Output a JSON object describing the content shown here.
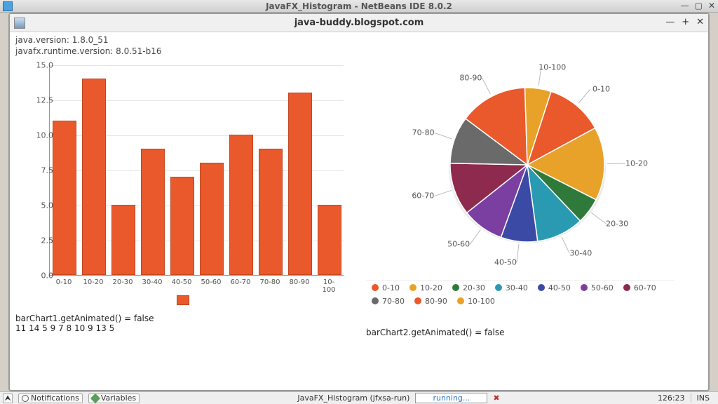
{
  "outer_window_title": "JavaFX_Histogram - NetBeans IDE 8.0.2",
  "inner_window_title": "java-buddy.blogspot.com",
  "sysinfo": {
    "line1": "java.version: 1.8.0_51",
    "line2": "javafx.runtime.version: 8.0.51-b16"
  },
  "bar_caption": "barChart1.getAnimated() = false",
  "bar_values_line": "11 14 5 9 7 8 10 9 13 5",
  "pie_caption": "barChart2.getAnimated() = false",
  "statusbar": {
    "notifications": "Notifications",
    "variables": "Variables",
    "task": "JavaFX_Histogram (jfxsa-run)",
    "running": "running...",
    "pos": "126:23",
    "ins": "INS"
  },
  "chart_data": [
    {
      "type": "bar",
      "title": "",
      "xlabel": "",
      "ylabel": "",
      "ylim": [
        0,
        15
      ],
      "yticks": [
        0.0,
        2.5,
        5.0,
        7.5,
        10.0,
        12.5,
        15.0
      ],
      "categories": [
        "0-10",
        "10-20",
        "20-30",
        "30-40",
        "40-50",
        "50-60",
        "60-70",
        "70-80",
        "80-90",
        "10-100"
      ],
      "values": [
        11,
        14,
        5,
        9,
        7,
        8,
        10,
        9,
        13,
        5
      ],
      "series_color": "#e9592c"
    },
    {
      "type": "pie",
      "title": "",
      "categories": [
        "0-10",
        "10-20",
        "20-30",
        "30-40",
        "40-50",
        "50-60",
        "60-70",
        "70-80",
        "80-90",
        "10-100"
      ],
      "values": [
        11,
        14,
        5,
        9,
        7,
        8,
        10,
        9,
        13,
        5
      ],
      "colors": [
        "#e9592c",
        "#e8a22a",
        "#2f7a3a",
        "#2a9ab2",
        "#3a4aa5",
        "#7a3fa0",
        "#8e2a4e",
        "#6a6a6a",
        "#e9592c",
        "#e8a22a"
      ]
    }
  ]
}
